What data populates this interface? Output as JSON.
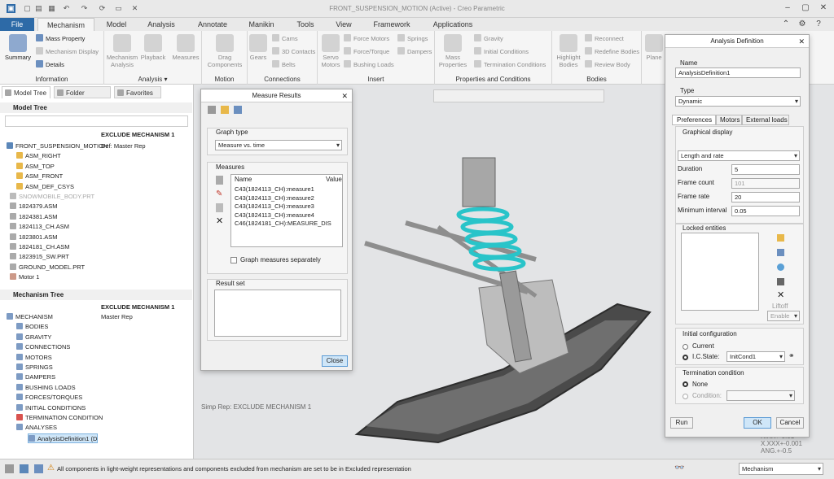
{
  "window": {
    "title": "FRONT_SUSPENSION_MOTION (Active) - Creo Parametric"
  },
  "ribbon_tabs": [
    "File",
    "Mechanism",
    "Model",
    "Analysis",
    "Annotate",
    "Manikin",
    "Tools",
    "View",
    "Framework",
    "Applications"
  ],
  "ribbon": {
    "summary": "Summary",
    "mass_property": "Mass Property",
    "mechanism_display": "Mechanism Display",
    "details": "Details",
    "information_label": "Information",
    "mechanism_analysis": "Mechanism Analysis",
    "playback": "Playback",
    "measures": "Measures",
    "analysis_label": "Analysis ▾",
    "drag_components": "Drag Components",
    "motion_label": "Motion",
    "gears": "Gears",
    "cams": "Cams",
    "contacts_3d": "3D Contacts",
    "belts": "Belts",
    "connections_label": "Connections",
    "servo_motors": "Servo Motors",
    "force_motors": "Force Motors",
    "force_torque": "Force/Torque",
    "bushing_loads": "Bushing Loads",
    "springs": "Springs",
    "dampers": "Dampers",
    "insert_label": "Insert",
    "mass_properties": "Mass Properties",
    "gravity": "Gravity",
    "initial_conditions": "Initial Conditions",
    "termination_conditions": "Termination Conditions",
    "props_label": "Properties and Conditions",
    "highlight_bodies": "Highlight Bodies",
    "reconnect": "Reconnect",
    "redefine_bodies": "Redefine Bodies",
    "review_body": "Review Body",
    "bodies_label": "Bodies",
    "plane": "Plane"
  },
  "left_panel": {
    "tabs": [
      "Model Tree",
      "Folder Browser",
      "Favorites"
    ],
    "model_tree_title": "Model Tree",
    "col_header": "EXCLUDE MECHANISM 1",
    "col_value": "Def: Master Rep",
    "model_items": [
      "FRONT_SUSPENSION_MOTION",
      "ASM_RIGHT",
      "ASM_TOP",
      "ASM_FRONT",
      "ASM_DEF_CSYS",
      "SNOWMOBILE_BODY.PRT",
      "1824379.ASM",
      "1824381.ASM",
      "1824113_CH.ASM",
      "1823801.ASM",
      "1824181_CH.ASM",
      "1823915_SW.PRT",
      "GROUND_MODEL.PRT",
      "Motor 1"
    ],
    "mech_tree_title": "Mechanism Tree",
    "mech_col_header": "EXCLUDE MECHANISM 1",
    "mech_col_value": "Master Rep",
    "mech_items": [
      "MECHANISM",
      "BODIES",
      "GRAVITY",
      "CONNECTIONS",
      "MOTORS",
      "SPRINGS",
      "DAMPERS",
      "BUSHING LOADS",
      "FORCES/TORQUES",
      "INITIAL CONDITIONS",
      "TERMINATION CONDITION",
      "ANALYSES",
      "AnalysisDefinition1 (D"
    ]
  },
  "measure_results": {
    "title": "Measure Results",
    "graph_type_label": "Graph type",
    "graph_type_value": "Measure vs. time",
    "measures_label": "Measures",
    "col_name": "Name",
    "col_value": "Value",
    "rows": [
      "C43(1824113_CH):measure1",
      "C43(1824113_CH):measure2",
      "C43(1824113_CH):measure3",
      "C43(1824113_CH):measure4",
      "C46(1824181_CH):MEASURE_DIS"
    ],
    "graph_separately": "Graph measures separately",
    "result_set_label": "Result set",
    "close": "Close"
  },
  "viewport": {
    "simp_rep": "Simp Rep: EXCLUDE MECHANISM 1",
    "tol1": "X.XX+-0.01",
    "tol2": "X.XXX+-0.001",
    "tol3": "ANG.+-0.5"
  },
  "analysis_def": {
    "title": "Analysis Definition",
    "name_label": "Name",
    "name_value": "AnalysisDefinition1",
    "type_label": "Type",
    "type_value": "Dynamic",
    "tabs": [
      "Preferences",
      "Motors",
      "External loads"
    ],
    "graphical_display": "Graphical display",
    "gd_value": "Length and rate",
    "duration_label": "Duration",
    "duration_value": "5",
    "frame_count_label": "Frame count",
    "frame_count_value": "101",
    "frame_rate_label": "Frame rate",
    "frame_rate_value": "20",
    "min_interval_label": "Minimum interval",
    "min_interval_value": "0.05",
    "locked_label": "Locked entities",
    "liftoff": "Liftoff",
    "enable": "Enable",
    "init_config": "Initial configuration",
    "current": "Current",
    "ic_state": "I.C.State:",
    "ic_value": "InitCond1",
    "termination": "Termination condition",
    "none": "None",
    "condition": "Condition:",
    "run": "Run",
    "ok": "OK",
    "cancel": "Cancel"
  },
  "status": {
    "message": "All components in light-weight representations and components excluded from mechanism are set to be in Excluded representation",
    "mode": "Mechanism"
  },
  "colors": {
    "accent": "#2d6aa7",
    "spring": "#29c4c9",
    "ok_button": "#cfe6f8"
  }
}
